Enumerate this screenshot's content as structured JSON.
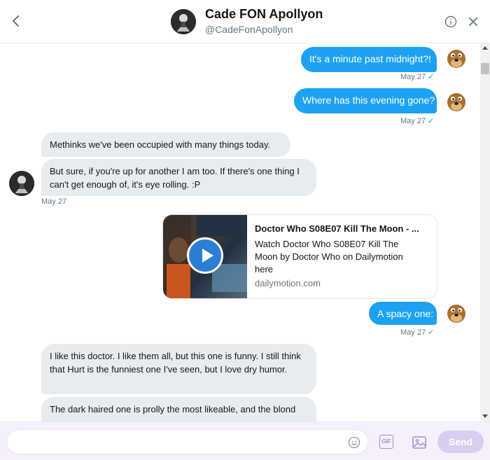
{
  "header": {
    "name": "Cade FON Apollyon",
    "handle": "@CadeFonApollyon",
    "back_icon": "chevron-left-icon",
    "info_icon": "info-icon",
    "close_icon": "close-icon"
  },
  "messages": [
    {
      "direction": "out",
      "text": "It's a minute past midnight?!",
      "time": "May 27"
    },
    {
      "direction": "out",
      "text": "Where has this evening gone?",
      "time": "May 27"
    },
    {
      "direction": "in",
      "text": "Methinks we've been occupied with many things today."
    },
    {
      "direction": "in",
      "text": "But sure, if you're up for another I am too. If there's one thing I can't get enough of, it's eye rolling. :P",
      "time": "May 27"
    },
    {
      "direction": "out",
      "text": "A spacy one:",
      "time": "May 27"
    },
    {
      "direction": "in",
      "text": "I like this doctor. I like them all, but this one is funny. I still think that Hurt is the funniest one I've seen, but I love dry humor."
    },
    {
      "direction": "in",
      "text": "The dark haired one is prolly the most likeable, and the blond"
    }
  ],
  "link_card": {
    "title": "Doctor Who S08E07 Kill The Moon - ...",
    "description": "Watch Doctor Who S08E07 Kill The Moon by Doctor Who on Dailymotion here",
    "domain": "dailymotion.com"
  },
  "composer": {
    "placeholder": "",
    "gif_label": "GIF",
    "send_label": "Send"
  },
  "colors": {
    "accent": "#1da1f2",
    "incoming_bubble": "#e6ecf0",
    "send_disabled": "#d9cdf0",
    "composer_bg": "#f5f0fb"
  }
}
